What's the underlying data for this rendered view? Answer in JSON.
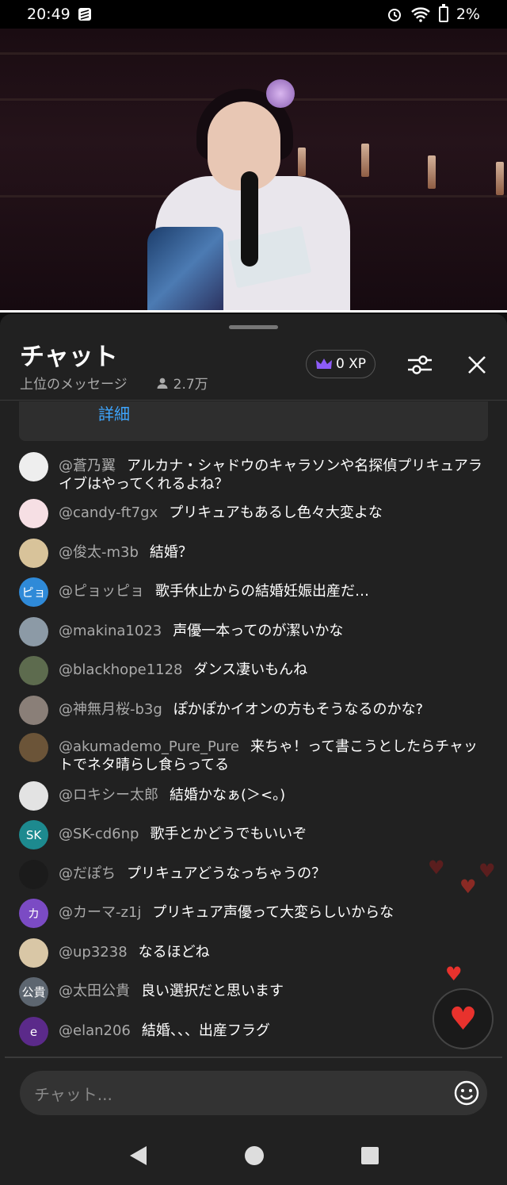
{
  "status_bar": {
    "time": "20:49",
    "battery": "2%"
  },
  "chat_header": {
    "title": "チャット",
    "mode": "上位のメッセージ",
    "viewers": "2.7万",
    "xp": "0 XP"
  },
  "detail_link": "詳細",
  "messages": [
    {
      "author": "@蒼乃翼",
      "text": "アルカナ・シャドウのキャラソンや名探偵プリキュアライブはやってくれるよね？",
      "avatar_text": "",
      "avatar_color": "#eeeeee"
    },
    {
      "author": "@candy-ft7gx",
      "text": "プリキュアもあるし色々大変よな",
      "avatar_text": "",
      "avatar_color": "#f6dfe4"
    },
    {
      "author": "@俊太-m3b",
      "text": "結婚？",
      "avatar_text": "",
      "avatar_color": "#d8c39a"
    },
    {
      "author": "@ピョッピョ",
      "text": "歌手休止からの結婚妊娠出産だ…",
      "avatar_text": "ピョ",
      "avatar_color": "#2f8ad8"
    },
    {
      "author": "@makina1023",
      "text": "声優一本ってのが潔いかな",
      "avatar_text": "",
      "avatar_color": "#8c9aa6"
    },
    {
      "author": "@blackhope1128",
      "text": "ダンス凄いもんね",
      "avatar_text": "",
      "avatar_color": "#5d6b4e"
    },
    {
      "author": "@神無月桜-b3g",
      "text": "ぽかぽかイオンの方もそうなるのかな?",
      "avatar_text": "",
      "avatar_color": "#8a7f78"
    },
    {
      "author": "@akumademo_Pure_Pure",
      "text": "来ちゃ！って書こうとしたらチャットでネタ晴らし食らってる",
      "avatar_text": "",
      "avatar_color": "#6b5438"
    },
    {
      "author": "@ロキシー太郎",
      "text": "結婚かなぁ(＞<。)",
      "avatar_text": "",
      "avatar_color": "#e3e3e3"
    },
    {
      "author": "@SK-cd6np",
      "text": "歌手とかどうでもいいぞ",
      "avatar_text": "SK",
      "avatar_color": "#1d8a8f"
    },
    {
      "author": "@だぽち",
      "text": "プリキュアどうなっちゃうの？",
      "avatar_text": "",
      "avatar_color": "#1b1b1b"
    },
    {
      "author": "@カーマ-z1j",
      "text": "プリキュア声優って大変らしいからな",
      "avatar_text": "カ",
      "avatar_color": "#7b4bc4"
    },
    {
      "author": "@up3238",
      "text": "なるほどね",
      "avatar_text": "",
      "avatar_color": "#d9c7a6"
    },
    {
      "author": "@太田公貴",
      "text": "良い選択だと思います",
      "avatar_text": "公貴",
      "avatar_color": "#5d6670"
    },
    {
      "author": "@elan206",
      "text": "結婚、、、出産フラグ",
      "avatar_text": "e",
      "avatar_color": "#5b2a8a"
    }
  ],
  "chat_input": {
    "placeholder": "チャット..."
  },
  "colors": {
    "accent_link": "#3ea6ff",
    "heart": "#e8322d",
    "crown": "#8d5cf6"
  },
  "icons": [
    "crown-icon",
    "person-icon",
    "filter-icon",
    "close-icon",
    "heart-icon",
    "emoji-icon",
    "back-icon",
    "home-icon",
    "recents-icon"
  ]
}
